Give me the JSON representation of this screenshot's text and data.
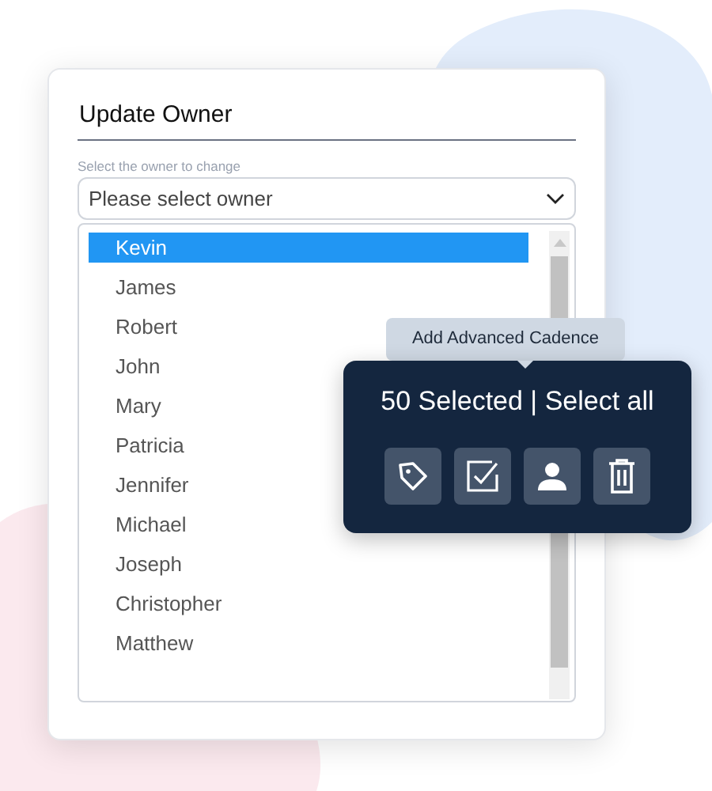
{
  "dialog": {
    "title": "Update Owner",
    "field_label": "Select the owner to change",
    "select": {
      "placeholder": "Please select owner"
    },
    "options": [
      {
        "label": "Kevin",
        "selected": true
      },
      {
        "label": "James",
        "selected": false
      },
      {
        "label": "Robert",
        "selected": false
      },
      {
        "label": "John",
        "selected": false
      },
      {
        "label": "Mary",
        "selected": false
      },
      {
        "label": "Patricia",
        "selected": false
      },
      {
        "label": "Jennifer",
        "selected": false
      },
      {
        "label": "Michael",
        "selected": false
      },
      {
        "label": "Joseph",
        "selected": false
      },
      {
        "label": "Christopher",
        "selected": false
      },
      {
        "label": "Matthew",
        "selected": false
      }
    ]
  },
  "tooltip": {
    "text": "Add Advanced Cadence"
  },
  "selection_bar": {
    "summary": "50 Selected | Select all"
  }
}
